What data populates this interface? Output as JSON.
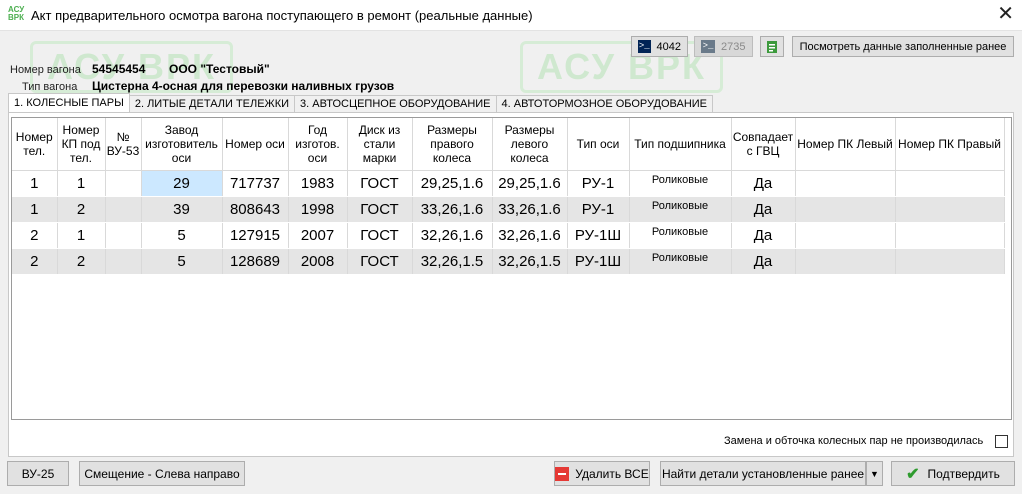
{
  "window": {
    "title": "Акт предварительного осмотра вагона поступающего в ремонт (реальные данные)",
    "app_icon_text": "АСУ ВРК"
  },
  "watermark": "АСУ ВРК",
  "toolbar": {
    "btn_4042": "4042",
    "btn_2735": "2735",
    "view_filled": "Посмотреть данные заполненные ранее"
  },
  "wagon": {
    "number_label": "Номер вагона",
    "number_value": "54545454",
    "company": "ООО \"Тестовый\"",
    "type_label": "Тип вагона",
    "type_value": "Цистерна 4-осная для перевозки наливных грузов"
  },
  "tabs": [
    "1. КОЛЕСНЫЕ ПАРЫ",
    "2. ЛИТЫЕ ДЕТАЛИ ТЕЛЕЖКИ",
    "3. АВТОСЦЕПНОЕ ОБОРУДОВАНИЕ",
    "4. АВТОТОРМОЗНОЕ ОБОРУДОВАНИЕ"
  ],
  "table": {
    "columns": [
      "Номер тел.",
      "Номер КП под тел.",
      "№ ВУ-53",
      "Завод изготовитель оси",
      "Номер оси",
      "Год изготов. оси",
      "Диск из стали марки",
      "Размеры правого колеса",
      "Размеры левого колеса",
      "Тип оси",
      "Тип подшипника",
      "Совпадает с ГВЦ",
      "Номер ПК Левый",
      "Номер ПК Правый"
    ],
    "rows": [
      [
        "1",
        "1",
        "",
        "29",
        "717737",
        "1983",
        "ГОСТ",
        "29,25,1.6",
        "29,25,1.6",
        "РУ-1",
        "Роликовые",
        "Да",
        "",
        ""
      ],
      [
        "1",
        "2",
        "",
        "39",
        "808643",
        "1998",
        "ГОСТ",
        "33,26,1.6",
        "33,26,1.6",
        "РУ-1",
        "Роликовые",
        "Да",
        "",
        ""
      ],
      [
        "2",
        "1",
        "",
        "5",
        "127915",
        "2007",
        "ГОСТ",
        "32,26,1.6",
        "32,26,1.6",
        "РУ-1Ш",
        "Роликовые",
        "Да",
        "",
        ""
      ],
      [
        "2",
        "2",
        "",
        "5",
        "128689",
        "2008",
        "ГОСТ",
        "32,26,1.5",
        "32,26,1.5",
        "РУ-1Ш",
        "Роликовые",
        "Да",
        "",
        ""
      ]
    ]
  },
  "replace_checkbox_label": "Замена и обточка колесных пар не производилась",
  "bottom": {
    "vu25": "ВУ-25",
    "offset": "Смещение - Слева направо",
    "delete_all": "Удалить ВСЕ",
    "find_parts": "Найти детали установленные ранее",
    "confirm": "Подтвердить"
  },
  "colors": {
    "selected_cell": "#cce8ff",
    "alt_row": "#e5e5e5",
    "watermark": "#cfe8cf",
    "delete_icon": "#e53935",
    "confirm_check": "#2e9b2e"
  }
}
